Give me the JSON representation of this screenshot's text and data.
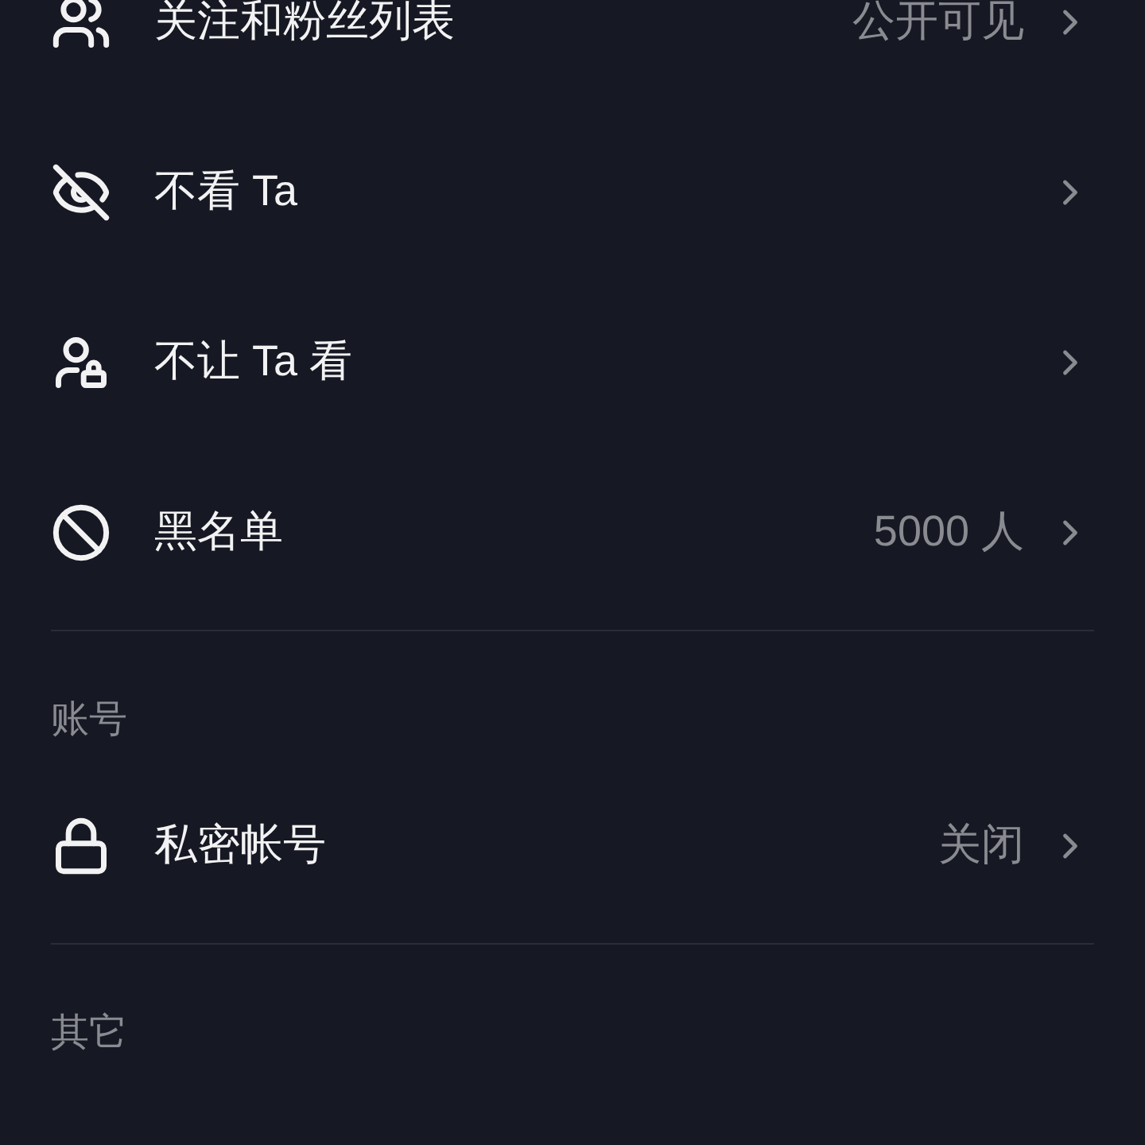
{
  "sections": [
    {
      "items": [
        {
          "label": "关注和粉丝列表",
          "value": "公开可见"
        },
        {
          "label": "不看 Ta"
        },
        {
          "label": "不让 Ta 看"
        },
        {
          "label": "黑名单",
          "value": "5000 人"
        }
      ]
    },
    {
      "header": "账号",
      "items": [
        {
          "label": "私密帐号",
          "value": "关闭"
        }
      ]
    },
    {
      "header": "其它"
    }
  ]
}
